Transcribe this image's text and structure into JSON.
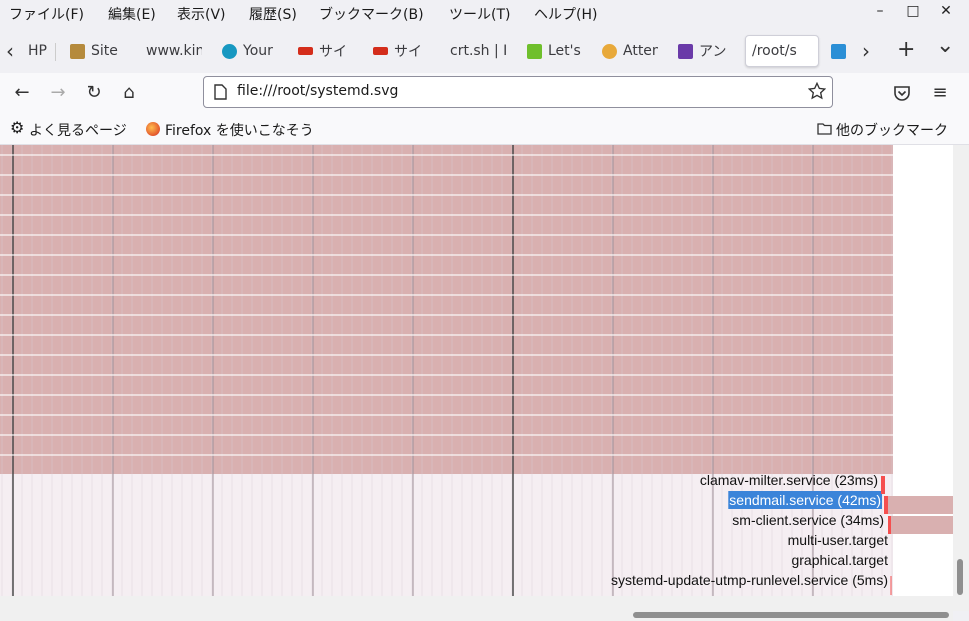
{
  "menubar": {
    "items": [
      "ファイル(F)",
      "編集(E)",
      "表示(V)",
      "履歴(S)",
      "ブックマーク(B)",
      "ツール(T)",
      "ヘルプ(H)"
    ]
  },
  "window": {
    "minimize": "–",
    "maximize": "□",
    "close": "✕"
  },
  "tabs": [
    {
      "label": "HP",
      "favicon": "none"
    },
    {
      "label": "Site",
      "favicon": "site-icon",
      "color": "#b58a3c"
    },
    {
      "label": "www.kin",
      "favicon": "none"
    },
    {
      "label": "Your",
      "favicon": "salesforce-icon",
      "color": "#1798c1"
    },
    {
      "label": "サイ",
      "favicon": "brand-icon",
      "color": "#d42d1b"
    },
    {
      "label": "サイ",
      "favicon": "brand-icon",
      "color": "#d42d1b"
    },
    {
      "label": "crt.sh | I",
      "favicon": "none"
    },
    {
      "label": "Let's",
      "favicon": "it-icon",
      "color": "#6fbf2c"
    },
    {
      "label": "Atten",
      "favicon": "badge-icon",
      "color": "#e8a93a"
    },
    {
      "label": "アン",
      "favicon": "image-icon",
      "color": "#6a3aa8"
    },
    {
      "label": "/root/s",
      "favicon": "none",
      "active": true
    },
    {
      "label": "",
      "favicon": "blue-icon",
      "color": "#2b8fd6"
    }
  ],
  "tabbar": {
    "scroll_left": "‹",
    "scroll_right": "›",
    "new_tab": "+",
    "list": "⌄"
  },
  "nav": {
    "back": "←",
    "forward": "→",
    "reload": "↻",
    "home": "⌂"
  },
  "url": {
    "value": "file:///root/systemd.svg"
  },
  "toolbar_icons": {
    "pocket": "pocket-icon",
    "menu": "≡"
  },
  "bookmarks": {
    "left": [
      {
        "label": "よく見るページ",
        "icon": "gear-icon"
      },
      {
        "label": "Firefox を使いこなそう",
        "icon": "firefox-icon"
      }
    ],
    "right": {
      "label": "他のブックマーク",
      "icon": "folder-icon"
    }
  },
  "svg_content": {
    "colors": {
      "block": "#d9b0b0",
      "activating": "#f54f4f",
      "bg": "#f5eef2"
    },
    "services": [
      {
        "label": "clamav-milter.service (23ms)",
        "highlight": false
      },
      {
        "label": "sendmail.service (42ms)",
        "highlight": true
      },
      {
        "label": "sm-client.service (34ms)",
        "highlight": false
      },
      {
        "label": "multi-user.target",
        "highlight": false
      },
      {
        "label": "graphical.target",
        "highlight": false
      },
      {
        "label": "systemd-update-utmp-runlevel.service (5ms)",
        "highlight": false
      }
    ]
  }
}
